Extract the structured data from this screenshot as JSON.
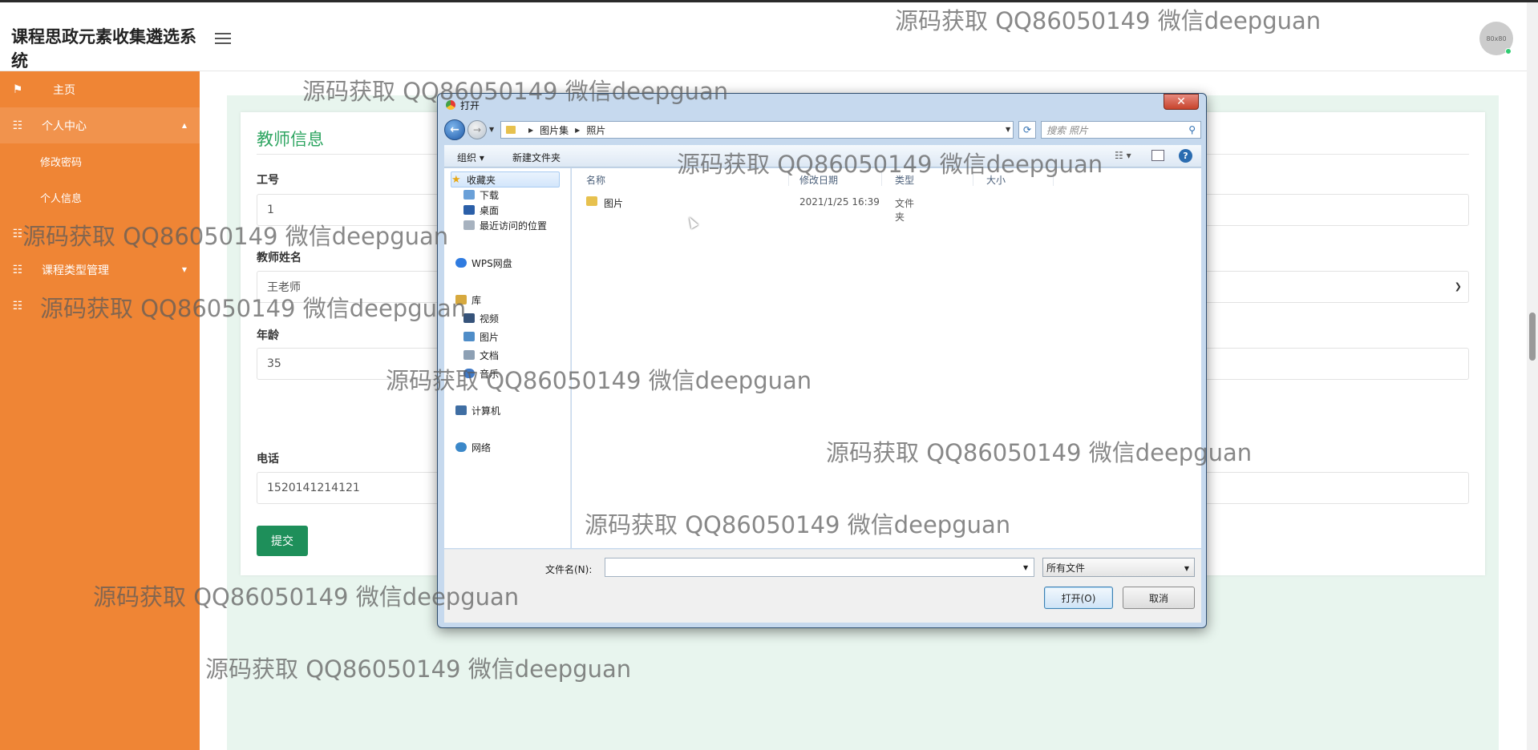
{
  "app": {
    "title": "课程思政元素收集遴选系统",
    "avatar_text": "80x80"
  },
  "sidebar": {
    "items": [
      {
        "label": "主页",
        "icon": "flag-icon"
      },
      {
        "label": "个人中心",
        "icon": "grid-icon",
        "expanded": true,
        "children": [
          {
            "label": "修改密码"
          },
          {
            "label": "个人信息"
          }
        ]
      },
      {
        "label": "",
        "icon": "grid-icon"
      },
      {
        "label": "课程类型管理",
        "icon": "grid-icon"
      },
      {
        "label": "",
        "icon": "grid-icon"
      }
    ]
  },
  "form": {
    "title": "教师信息",
    "fields": [
      {
        "label": "工号",
        "value": "1"
      },
      {
        "label": "教师姓名",
        "value": "王老师"
      },
      {
        "label": "年龄",
        "value": "35"
      },
      {
        "label": "电话",
        "value": "1520141214121"
      }
    ],
    "submit_label": "提交"
  },
  "dialog": {
    "title": "打开",
    "close_label": "✕",
    "breadcrumb": [
      "图片集",
      "照片"
    ],
    "search_placeholder": "搜索 照片",
    "toolbar": {
      "organize": "组织 ▾",
      "new_folder": "新建文件夹"
    },
    "nav_pane": {
      "favorites": "收藏夹",
      "favorite_items": [
        "下载",
        "桌面",
        "最近访问的位置"
      ],
      "wps": "WPS网盘",
      "libraries": "库",
      "library_items": [
        "视频",
        "图片",
        "文档",
        "音乐"
      ],
      "computer": "计算机",
      "network": "网络"
    },
    "columns": [
      "名称",
      "修改日期",
      "类型",
      "大小"
    ],
    "files": [
      {
        "name": "图片",
        "modified": "2021/1/25 16:39",
        "type": "文件夹",
        "size": ""
      }
    ],
    "filename_label": "文件名(N):",
    "filename_value": "",
    "filter": "所有文件",
    "open_button": "打开(O)",
    "cancel_button": "取消"
  },
  "watermark": "源码获取 QQ86050149 微信deepguan"
}
